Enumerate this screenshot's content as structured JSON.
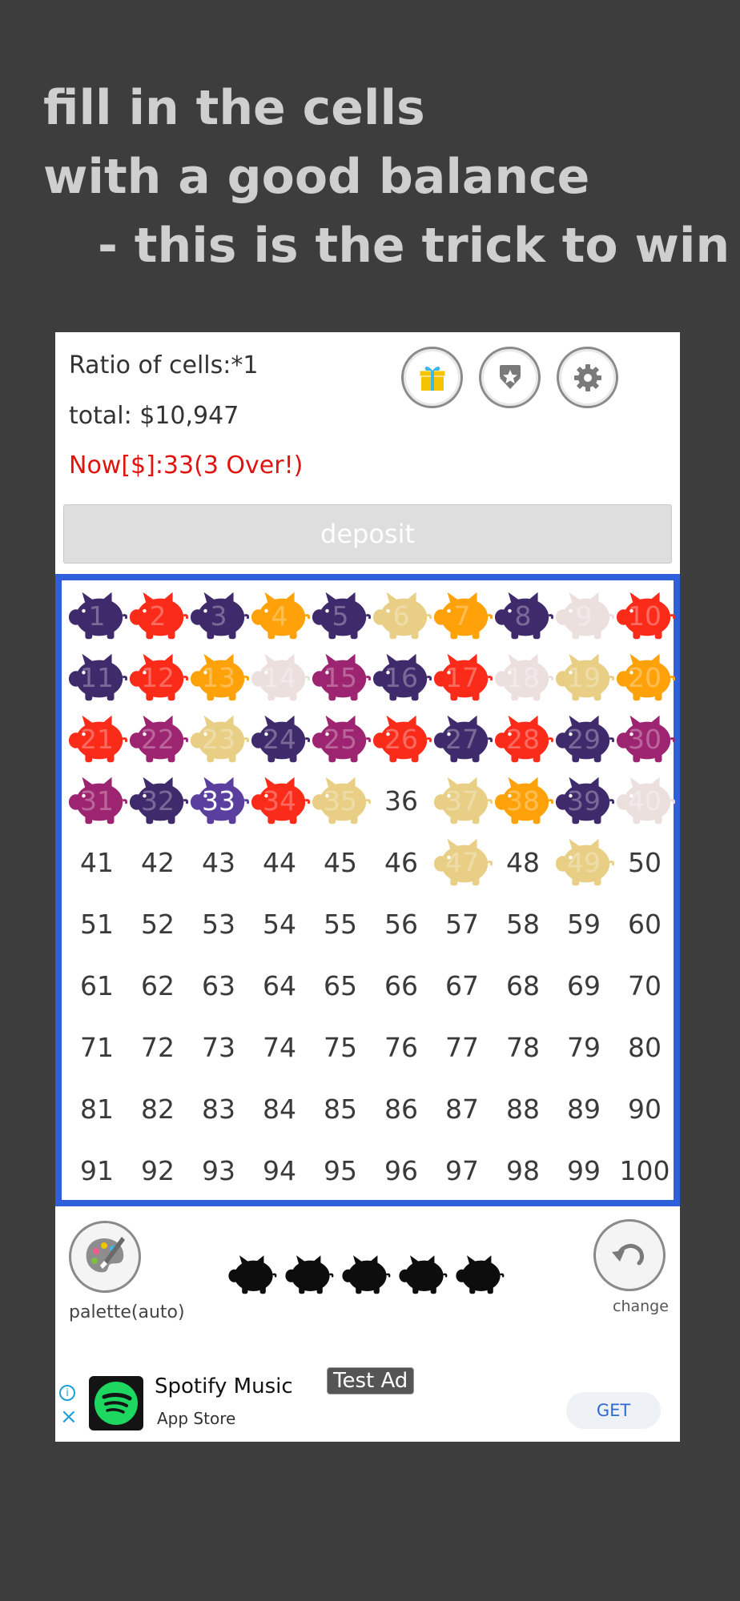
{
  "headline": {
    "line1": "fill in the cells",
    "line2": "with a good balance",
    "line3": "- this is the trick to win"
  },
  "status": {
    "ratio": "Ratio of cells:*1",
    "total": "total: $10,947",
    "now": "Now[$]:33(3 Over!)"
  },
  "toolbar_icons": [
    "gift-icon",
    "award-icon",
    "gear-icon"
  ],
  "deposit_label": "deposit",
  "colors": {
    "purple": "#3f2a6b",
    "red": "#fb2b1a",
    "orange": "#ffa20a",
    "beige": "#e9cf85",
    "pink": "#ece0de",
    "magenta": "#9c2470",
    "current": "#5b3f9e",
    "board_border": "#2f5fd9",
    "alert": "#e0140f"
  },
  "cells": [
    {
      "n": "1",
      "c": "purple"
    },
    {
      "n": "2",
      "c": "red"
    },
    {
      "n": "3",
      "c": "purple"
    },
    {
      "n": "4",
      "c": "orange"
    },
    {
      "n": "5",
      "c": "purple"
    },
    {
      "n": "6",
      "c": "beige"
    },
    {
      "n": "7",
      "c": "orange"
    },
    {
      "n": "8",
      "c": "purple"
    },
    {
      "n": "9",
      "c": "pink"
    },
    {
      "n": "10",
      "c": "red"
    },
    {
      "n": "11",
      "c": "purple"
    },
    {
      "n": "12",
      "c": "red"
    },
    {
      "n": "13",
      "c": "orange"
    },
    {
      "n": "14",
      "c": "pink"
    },
    {
      "n": "15",
      "c": "magenta"
    },
    {
      "n": "16",
      "c": "purple"
    },
    {
      "n": "17",
      "c": "red"
    },
    {
      "n": "18",
      "c": "pink"
    },
    {
      "n": "19",
      "c": "beige"
    },
    {
      "n": "20",
      "c": "orange"
    },
    {
      "n": "21",
      "c": "red"
    },
    {
      "n": "22",
      "c": "magenta"
    },
    {
      "n": "23",
      "c": "beige"
    },
    {
      "n": "24",
      "c": "purple"
    },
    {
      "n": "25",
      "c": "magenta"
    },
    {
      "n": "26",
      "c": "red"
    },
    {
      "n": "27",
      "c": "purple"
    },
    {
      "n": "28",
      "c": "red"
    },
    {
      "n": "29",
      "c": "purple"
    },
    {
      "n": "30",
      "c": "magenta"
    },
    {
      "n": "31",
      "c": "magenta"
    },
    {
      "n": "32",
      "c": "purple"
    },
    {
      "n": "33",
      "c": "current"
    },
    {
      "n": "34",
      "c": "red"
    },
    {
      "n": "35",
      "c": "beige"
    },
    {
      "n": "36",
      "c": ""
    },
    {
      "n": "37",
      "c": "beige"
    },
    {
      "n": "38",
      "c": "orange"
    },
    {
      "n": "39",
      "c": "purple"
    },
    {
      "n": "40",
      "c": "pink"
    },
    {
      "n": "41",
      "c": ""
    },
    {
      "n": "42",
      "c": ""
    },
    {
      "n": "43",
      "c": ""
    },
    {
      "n": "44",
      "c": ""
    },
    {
      "n": "45",
      "c": ""
    },
    {
      "n": "46",
      "c": ""
    },
    {
      "n": "47",
      "c": "beige"
    },
    {
      "n": "48",
      "c": ""
    },
    {
      "n": "49",
      "c": "beige"
    },
    {
      "n": "50",
      "c": ""
    },
    {
      "n": "51",
      "c": ""
    },
    {
      "n": "52",
      "c": ""
    },
    {
      "n": "53",
      "c": ""
    },
    {
      "n": "54",
      "c": ""
    },
    {
      "n": "55",
      "c": ""
    },
    {
      "n": "56",
      "c": ""
    },
    {
      "n": "57",
      "c": ""
    },
    {
      "n": "58",
      "c": ""
    },
    {
      "n": "59",
      "c": ""
    },
    {
      "n": "60",
      "c": ""
    },
    {
      "n": "61",
      "c": ""
    },
    {
      "n": "62",
      "c": ""
    },
    {
      "n": "63",
      "c": ""
    },
    {
      "n": "64",
      "c": ""
    },
    {
      "n": "65",
      "c": ""
    },
    {
      "n": "66",
      "c": ""
    },
    {
      "n": "67",
      "c": ""
    },
    {
      "n": "68",
      "c": ""
    },
    {
      "n": "69",
      "c": ""
    },
    {
      "n": "70",
      "c": ""
    },
    {
      "n": "71",
      "c": ""
    },
    {
      "n": "72",
      "c": ""
    },
    {
      "n": "73",
      "c": ""
    },
    {
      "n": "74",
      "c": ""
    },
    {
      "n": "75",
      "c": ""
    },
    {
      "n": "76",
      "c": ""
    },
    {
      "n": "77",
      "c": ""
    },
    {
      "n": "78",
      "c": ""
    },
    {
      "n": "79",
      "c": ""
    },
    {
      "n": "80",
      "c": ""
    },
    {
      "n": "81",
      "c": ""
    },
    {
      "n": "82",
      "c": ""
    },
    {
      "n": "83",
      "c": ""
    },
    {
      "n": "84",
      "c": ""
    },
    {
      "n": "85",
      "c": ""
    },
    {
      "n": "86",
      "c": ""
    },
    {
      "n": "87",
      "c": ""
    },
    {
      "n": "88",
      "c": ""
    },
    {
      "n": "89",
      "c": ""
    },
    {
      "n": "90",
      "c": ""
    },
    {
      "n": "91",
      "c": ""
    },
    {
      "n": "92",
      "c": ""
    },
    {
      "n": "93",
      "c": ""
    },
    {
      "n": "94",
      "c": ""
    },
    {
      "n": "95",
      "c": ""
    },
    {
      "n": "96",
      "c": ""
    },
    {
      "n": "97",
      "c": ""
    },
    {
      "n": "98",
      "c": ""
    },
    {
      "n": "99",
      "c": ""
    },
    {
      "n": "100",
      "c": ""
    }
  ],
  "bottom": {
    "palette_label": "palette(auto)",
    "palette_icon": "palette-icon",
    "change_label": "change",
    "change_icon": "undo-icon",
    "pig_count": 5
  },
  "ad": {
    "title": "Spotify Music",
    "store": "App Store",
    "badge": "Test Ad",
    "cta": "GET",
    "info_glyph": "i",
    "close_glyph": "×"
  }
}
